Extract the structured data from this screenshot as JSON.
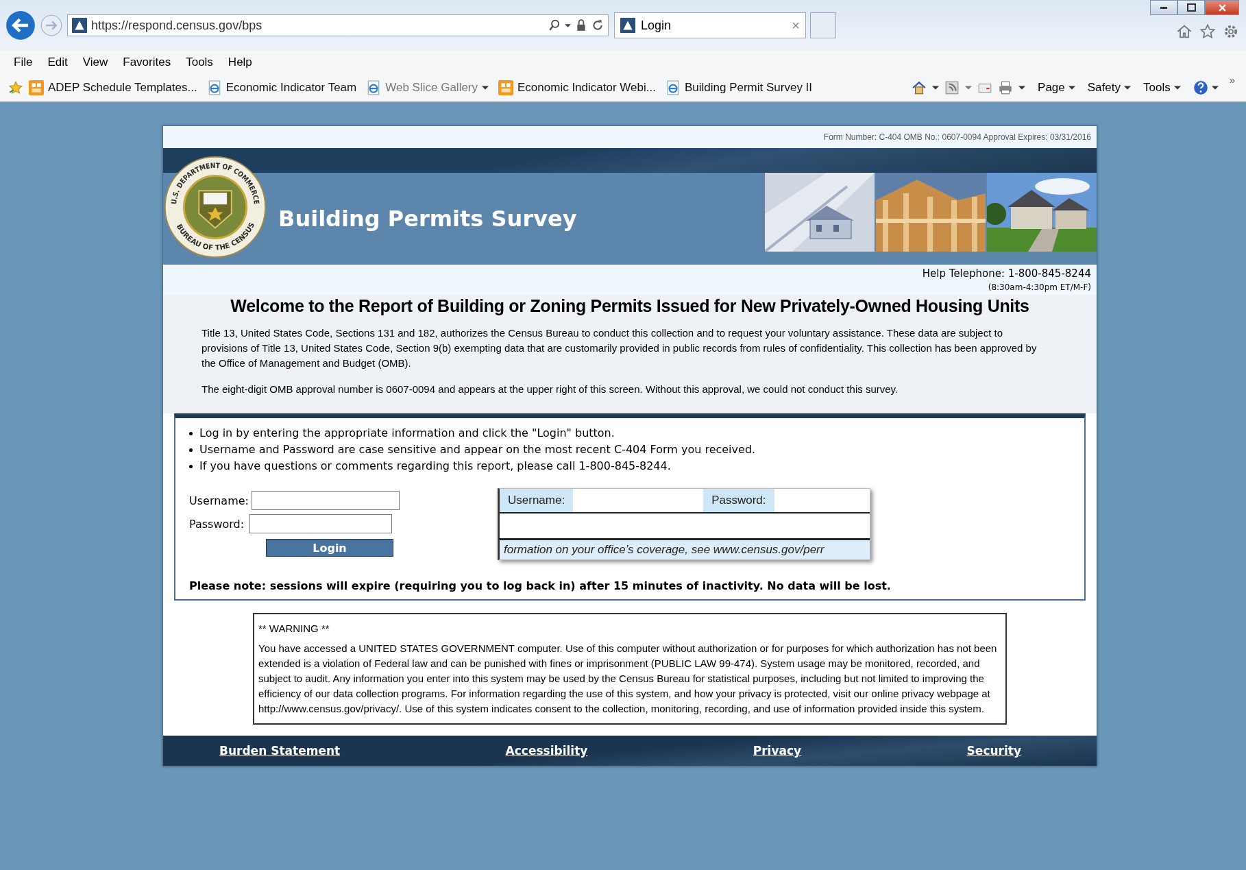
{
  "browser": {
    "url": "https://respond.census.gov/bps",
    "tab": {
      "title": "Login",
      "close": "×"
    },
    "menu": [
      "File",
      "Edit",
      "View",
      "Favorites",
      "Tools",
      "Help"
    ],
    "favorites": [
      {
        "label": "ADEP Schedule Templates...",
        "kind": "feed"
      },
      {
        "label": "Economic Indicator Team",
        "kind": "page"
      },
      {
        "label": "Web Slice Gallery",
        "kind": "gallery"
      },
      {
        "label": "Economic Indicator Webi...",
        "kind": "feed"
      },
      {
        "label": "Building Permit Survey II",
        "kind": "page"
      }
    ],
    "commands": [
      "Page",
      "Safety",
      "Tools"
    ],
    "overflow": "»"
  },
  "page": {
    "form_number": "Form Number: C-404 OMB No.: 0607-0094 Approval Expires: 03/31/2016",
    "seal_top": "U.S. DEPARTMENT OF COMMERCE",
    "seal_bottom": "BUREAU OF THE CENSUS",
    "title": "Building Permits Survey",
    "help_phone": "Help Telephone: 1-800-845-8244",
    "help_hours": "(8:30am-4:30pm ET/M-F)",
    "welcome": "Welcome to the Report of Building or Zoning Permits Issued for New Privately-Owned Housing Units",
    "paragraphs": [
      "Title 13, United States Code, Sections 131 and 182, authorizes the Census Bureau to conduct this collection and to request your voluntary assistance.  These data are subject to provisions of Title 13, United States Code, Section 9(b) exempting data that are customarily provided in public records from rules of confidentiality. This collection has been approved by the Office of Management and Budget (OMB).",
      "The eight-digit OMB approval number is 0607-0094 and appears at the upper right of this screen.  Without this approval, we could not conduct this survey."
    ],
    "instructions": [
      "Log in by entering the appropriate information and click the \"Login\" button.",
      "Username and Password are case sensitive and appear on the most recent C-404 Form you received.",
      "If you have questions or comments regarding this report, please call 1-800-845-8244."
    ],
    "login": {
      "username_label": "Username:",
      "password_label": "Password:",
      "button": "Login"
    },
    "form_excerpt": {
      "username_label": "Username:",
      "password_label": "Password:",
      "footer": "formation on your office’s coverage, see www.census.gov/perr"
    },
    "note": "Please note: sessions will expire (requiring you to log back in) after 15 minutes of inactivity. No data will be lost.",
    "warning": {
      "title": "** WARNING **",
      "text": "You have accessed a UNITED STATES GOVERNMENT computer. Use of this computer without authorization or for purposes for which authorization has not been extended is a violation of Federal law and can be punished with fines or imprisonment (PUBLIC LAW 99-474). System usage may be monitored, recorded, and subject to audit. Any information you enter into this system may be used by the Census Bureau for statistical purposes, including but not limited to improving the efficiency of our data collection programs. For information regarding the use of this system, and how your privacy is protected, visit our online privacy webpage at http://www.census.gov/privacy/. Use of this system indicates consent to the collection, monitoring, recording, and use of information provided inside this system."
    },
    "footer_links": [
      "Burden Statement",
      "Accessibility",
      "Privacy",
      "Security"
    ]
  }
}
